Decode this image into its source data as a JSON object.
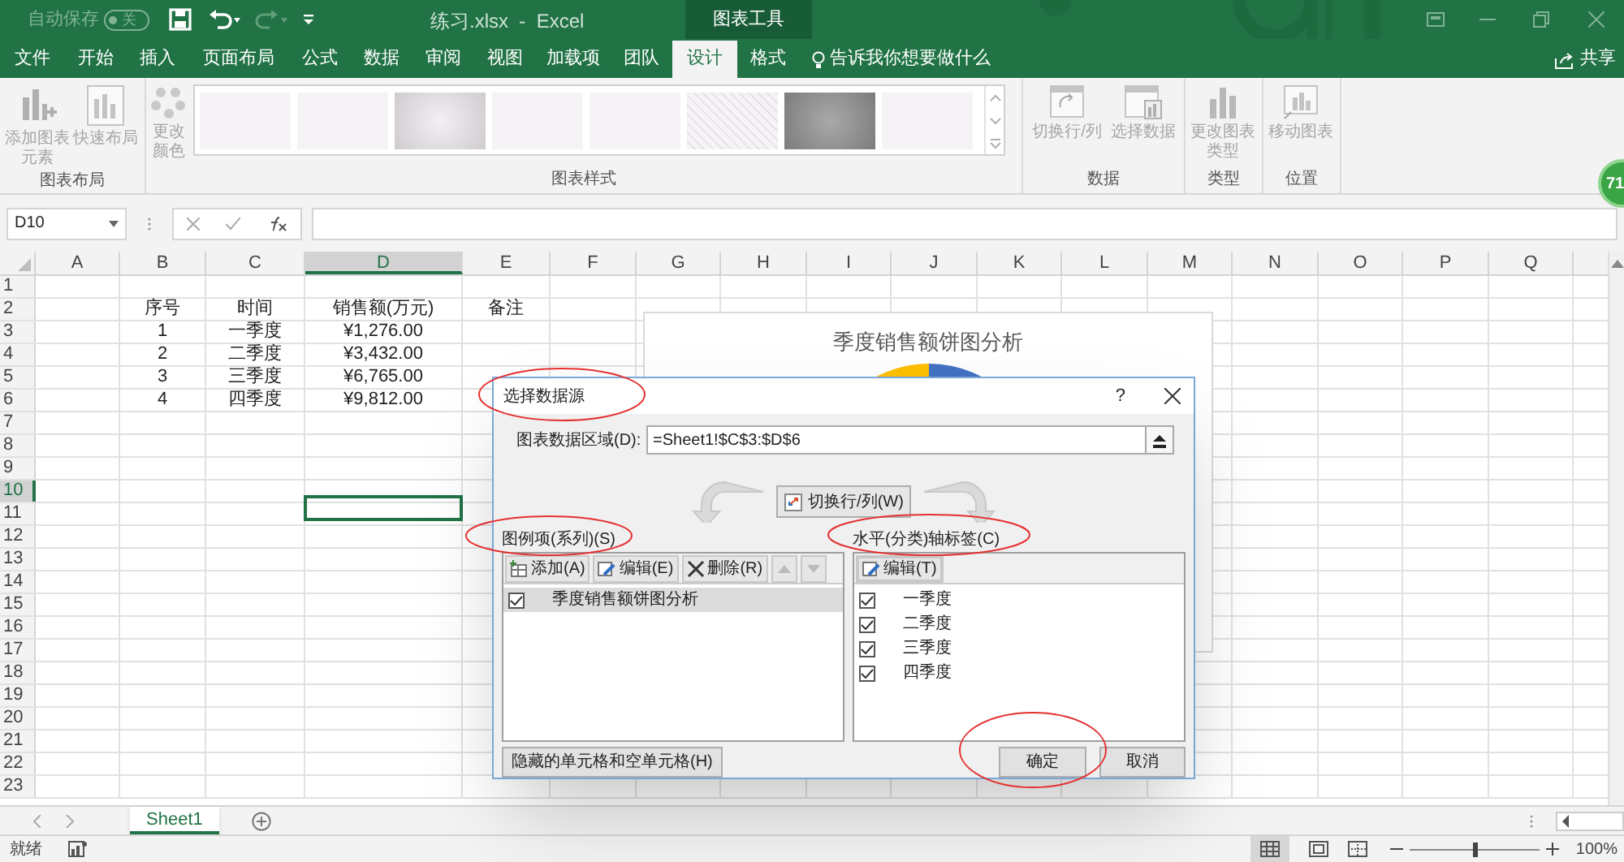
{
  "title_bar": {
    "autosave_label": "自动保存",
    "autosave_state": "关",
    "autosave_on": false,
    "title": "练习.xlsx  -  Excel",
    "context_tab": "图表工具"
  },
  "ribbon_tabs": [
    {
      "label": "文件",
      "selected": false
    },
    {
      "label": "开始",
      "selected": false
    },
    {
      "label": "插入",
      "selected": false
    },
    {
      "label": "页面布局",
      "selected": false
    },
    {
      "label": "公式",
      "selected": false
    },
    {
      "label": "数据",
      "selected": false
    },
    {
      "label": "审阅",
      "selected": false
    },
    {
      "label": "视图",
      "selected": false
    },
    {
      "label": "加载项",
      "selected": false
    },
    {
      "label": "团队",
      "selected": false
    },
    {
      "label": "设计",
      "selected": true
    },
    {
      "label": "格式",
      "selected": false
    }
  ],
  "tell_me": "告诉我你想要做什么",
  "share": "共享",
  "ribbon": {
    "layout_group": "图表布局",
    "add_element": "添加图表元素",
    "quick_layout": "快速布局",
    "change_colors": "更改颜色",
    "styles_group": "图表样式",
    "chart_styles": [
      {
        "kind": "plain"
      },
      {
        "kind": "plain"
      },
      {
        "kind": "gradient"
      },
      {
        "kind": "plain"
      },
      {
        "kind": "plain"
      },
      {
        "kind": "hatched"
      },
      {
        "kind": "dark"
      },
      {
        "kind": "plain"
      }
    ],
    "data_group": "数据",
    "switch_row_col": "切换行/列",
    "select_data": "选择数据",
    "type_group": "类型",
    "change_type": "更改图表类型",
    "location_group": "位置",
    "move_chart": "移动图表"
  },
  "badge": "71",
  "formula_bar": {
    "name_box": "D10"
  },
  "columns": [
    {
      "label": "A",
      "selected": false
    },
    {
      "label": "B",
      "selected": false
    },
    {
      "label": "C",
      "selected": false
    },
    {
      "label": "D",
      "selected": true
    },
    {
      "label": "E",
      "selected": false
    },
    {
      "label": "F",
      "selected": false
    },
    {
      "label": "G",
      "selected": false
    },
    {
      "label": "H",
      "selected": false
    },
    {
      "label": "I",
      "selected": false
    },
    {
      "label": "J",
      "selected": false
    },
    {
      "label": "K",
      "selected": false
    },
    {
      "label": "L",
      "selected": false
    },
    {
      "label": "M",
      "selected": false
    },
    {
      "label": "N",
      "selected": false
    },
    {
      "label": "O",
      "selected": false
    },
    {
      "label": "P",
      "selected": false
    },
    {
      "label": "Q",
      "selected": false
    }
  ],
  "rows": [
    {
      "label": "1",
      "selected": false,
      "cells": []
    },
    {
      "label": "2",
      "selected": false,
      "cells": {
        "b": "序号",
        "c": "时间",
        "d": "销售额(万元)",
        "e": "备注"
      }
    },
    {
      "label": "3",
      "selected": false,
      "cells": {
        "b": "1",
        "c": "一季度",
        "d": "¥1,276.00"
      }
    },
    {
      "label": "4",
      "selected": false,
      "cells": {
        "b": "2",
        "c": "二季度",
        "d": "¥3,432.00"
      }
    },
    {
      "label": "5",
      "selected": false,
      "cells": {
        "b": "3",
        "c": "三季度",
        "d": "¥6,765.00"
      }
    },
    {
      "label": "6",
      "selected": false,
      "cells": {
        "b": "4",
        "c": "四季度",
        "d": "¥9,812.00"
      }
    },
    {
      "label": "7",
      "selected": false,
      "cells": []
    },
    {
      "label": "8",
      "selected": false,
      "cells": []
    },
    {
      "label": "9",
      "selected": false,
      "cells": []
    },
    {
      "label": "10",
      "selected": true,
      "cells": []
    },
    {
      "label": "11",
      "selected": false,
      "cells": []
    },
    {
      "label": "12",
      "selected": false,
      "cells": []
    },
    {
      "label": "13",
      "selected": false,
      "cells": []
    },
    {
      "label": "14",
      "selected": false,
      "cells": []
    },
    {
      "label": "15",
      "selected": false,
      "cells": []
    },
    {
      "label": "16",
      "selected": false,
      "cells": []
    },
    {
      "label": "17",
      "selected": false,
      "cells": []
    },
    {
      "label": "18",
      "selected": false,
      "cells": []
    },
    {
      "label": "19",
      "selected": false,
      "cells": []
    },
    {
      "label": "20",
      "selected": false,
      "cells": []
    },
    {
      "label": "21",
      "selected": false,
      "cells": []
    },
    {
      "label": "22",
      "selected": false,
      "cells": []
    },
    {
      "label": "23",
      "selected": false,
      "cells": []
    }
  ],
  "chart": {
    "title": "季度销售额饼图分析"
  },
  "dialog": {
    "title": "选择数据源",
    "help": "?",
    "range_label": "图表数据区域(D):",
    "range_value": "=Sheet1!$C$3:$D$6",
    "switch_button": "切换行/列(W)",
    "series_label": "图例项(系列)(S)",
    "add_button": "添加(A)",
    "edit_button": "编辑(E)",
    "delete_button": "删除(R)",
    "series": [
      {
        "label": "季度销售额饼图分析",
        "checked": true,
        "selected": true
      }
    ],
    "axis_label": "水平(分类)轴标签(C)",
    "axis_edit_button": "编辑(T)",
    "categories": [
      {
        "label": "一季度",
        "checked": true
      },
      {
        "label": "二季度",
        "checked": true
      },
      {
        "label": "三季度",
        "checked": true
      },
      {
        "label": "四季度",
        "checked": true
      }
    ],
    "hidden_cells_button": "隐藏的单元格和空单元格(H)",
    "ok_button": "确定",
    "cancel_button": "取消"
  },
  "sheet_tabs": [
    {
      "label": "Sheet1",
      "selected": true
    }
  ],
  "status_bar": {
    "status": "就绪",
    "zoom": {
      "level": 0.5
    },
    "zoom_label": "100%"
  }
}
